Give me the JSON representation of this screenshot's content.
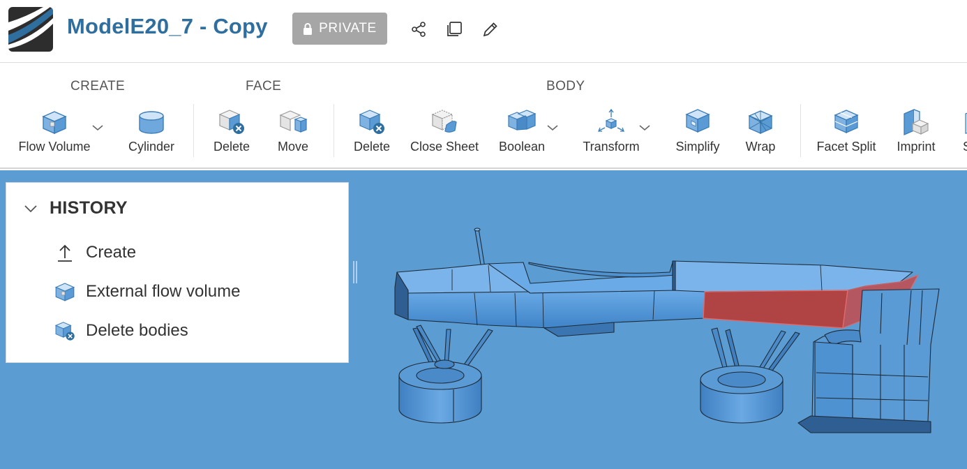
{
  "header": {
    "title": "ModelE20_7 - Copy",
    "visibility_badge": "PRIVATE",
    "icons": [
      "share-icon",
      "copy-icon",
      "edit-icon"
    ]
  },
  "toolbar": {
    "groups": {
      "create": "CREATE",
      "face": "FACE",
      "body": "BODY"
    },
    "tools": {
      "flow_volume": "Flow Volume",
      "cylinder": "Cylinder",
      "face_delete": "Delete",
      "face_move": "Move",
      "body_delete": "Delete",
      "close_sheet": "Close Sheet",
      "boolean": "Boolean",
      "transform": "Transform",
      "simplify": "Simplify",
      "wrap": "Wrap",
      "facet_split": "Facet Split",
      "imprint": "Imprint",
      "overflow_partial": "S"
    }
  },
  "history": {
    "title": "HISTORY",
    "items": [
      {
        "label": "Create",
        "icon": "upload-arrow-icon"
      },
      {
        "label": "External flow volume",
        "icon": "flow-volume-icon"
      },
      {
        "label": "Delete bodies",
        "icon": "delete-body-icon"
      }
    ]
  },
  "colors": {
    "brand": "#2f6f9f",
    "viewport_bg": "#5b9cd3",
    "model_body": "#4a90d4",
    "selected_face": "#b04040",
    "badge_bg": "#a6a6a6"
  }
}
